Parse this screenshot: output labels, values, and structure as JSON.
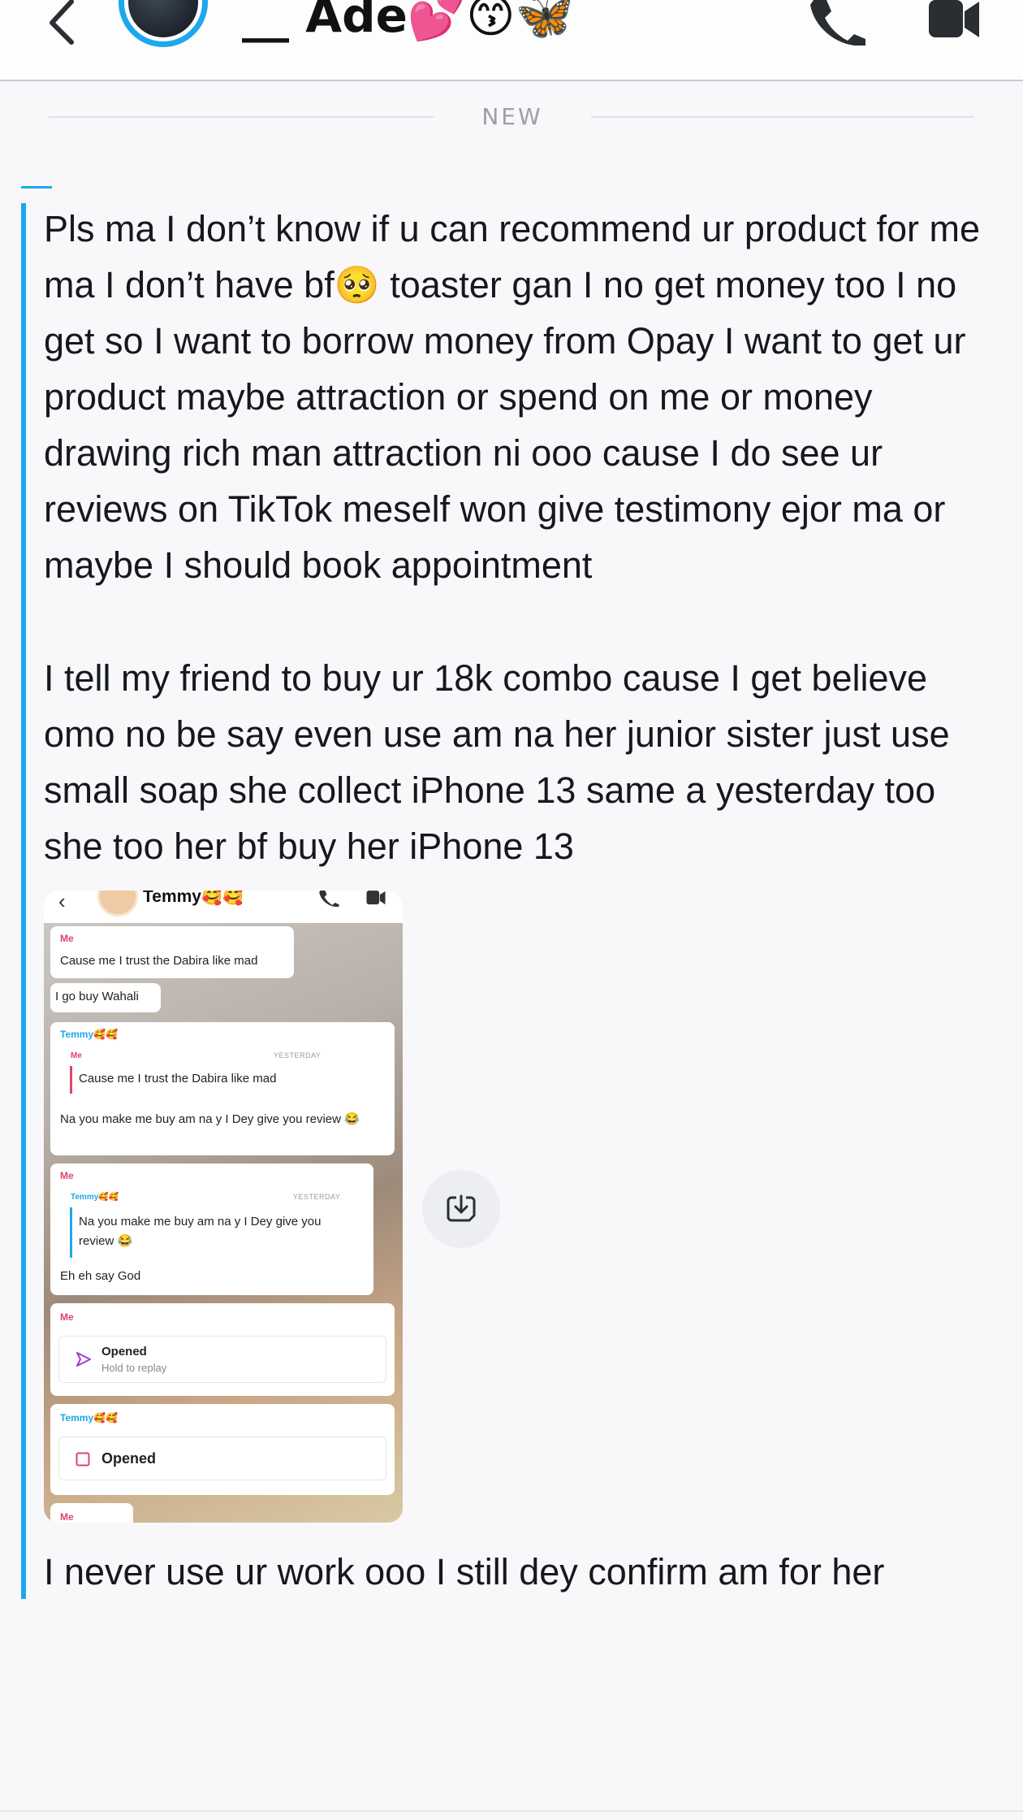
{
  "header": {
    "title": "__ Ade💕😙🦋",
    "back_icon": "chevron-left-icon",
    "call_icon": "phone-icon",
    "video_icon": "video-camera-icon",
    "accent_color": "#1da8ec"
  },
  "separator": {
    "label": "NEW"
  },
  "messages": [
    {
      "text": "Pls ma I don’t know if u can recommend ur product for me ma I don’t have bf🥺 toaster gan I no get money too I no get so I want to borrow money from Opay I want to get ur product maybe attraction or spend on me or money drawing rich man attraction ni ooo cause I do see ur reviews on TikTok meself won give testimony ejor ma or maybe I should book appointment"
    },
    {
      "text": "I tell my friend to buy ur 18k combo cause I get believe omo no be say even use am na her junior sister just use small soap she collect iPhone 13 same a yesterday too she too her bf buy her iPhone 13"
    },
    {
      "text": "I never use ur work ooo I still dey confirm am for her"
    }
  ],
  "attachment": {
    "contact_name": "Temmy🥰🥰",
    "me_label": "Me",
    "them_label": "Temmy🥰🥰",
    "msg1": "Cause me I trust the Dabira like mad",
    "msg2": "I go buy Wahali",
    "quote_date": "YESTERDAY",
    "quote1": "Cause me I trust the Dabira like mad",
    "reply1": "Na you make me buy am na y I Dey give you review 😂",
    "quote2": "Na you make me buy am na y I Dey give you review 😂",
    "reply2": "Eh eh say God",
    "opened_label": "Opened",
    "hold_label": "Hold to replay",
    "opened_label_2": "Opened"
  },
  "save_button": {
    "icon": "save-to-camera-roll-icon"
  }
}
